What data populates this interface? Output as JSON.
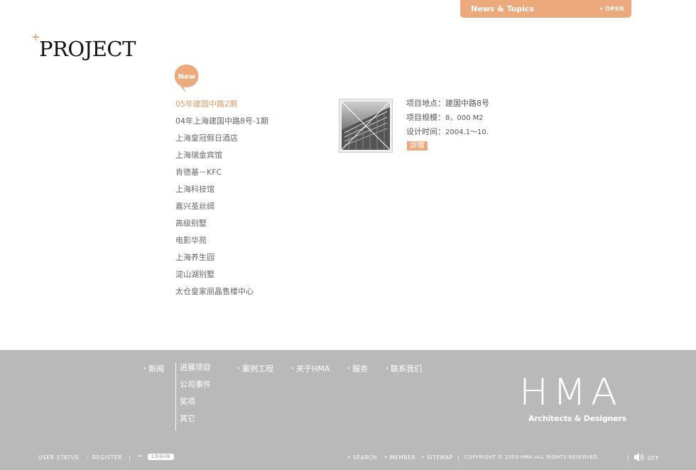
{
  "news_tab": {
    "label": "News & Topics",
    "open_label": "OPEN"
  },
  "header": {
    "plus": "+",
    "title": "PROJECT"
  },
  "new_badge": "New",
  "projects": [
    "05年建国中路2期",
    "04年上海建国中路8号-1期",
    "上海皇冠假日酒店",
    "上海瑞金宾馆",
    "肯德基－KFC",
    "上海科技馆",
    "嘉兴茧丝绸",
    "高级别墅",
    "电影华苑",
    "上海养生园",
    "淀山湖别墅",
    "太仓皇家丽晶售楼中心"
  ],
  "detail": {
    "location_label": "项目地点：",
    "location_value": "建国中路8号",
    "scale_label": "项目规模：",
    "scale_value": "8，000 M2",
    "time_label": "设计时间：",
    "time_value": "2004.1～10.",
    "details_button": "詳情"
  },
  "footer": {
    "nav": [
      "新闻",
      "进展项目",
      "案例工程",
      "关于HMA",
      "服务",
      "联系我们"
    ],
    "subnav": [
      "公司事件",
      "奖项",
      "其它"
    ],
    "brand": "HMA",
    "brand_sub": "Architects & Designers",
    "user_status": "USER STATUS",
    "register": "REGISTER",
    "login": "LOGIN",
    "links": [
      "SEARCH",
      "MEMBER",
      "SITEMAP"
    ],
    "copyright": "COPYRIGHT © 2003 HMA ALL RIGHTS RESERVED.",
    "sound": "OFF"
  },
  "colors": {
    "accent": "#eba97c",
    "active_text": "#e59a65",
    "footer_bg": "#b9b9b9"
  }
}
